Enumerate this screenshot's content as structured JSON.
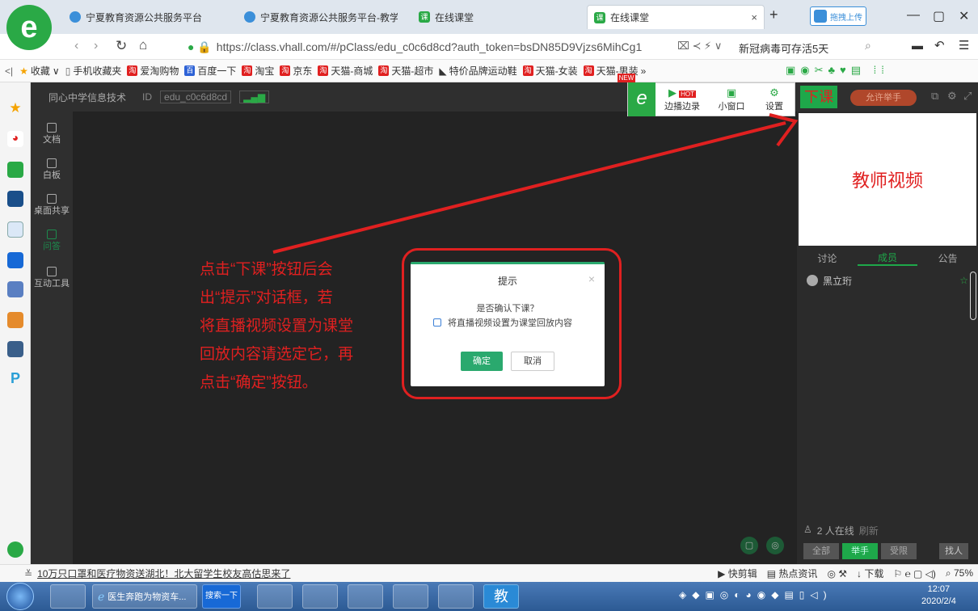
{
  "browser": {
    "tabs": [
      {
        "label": "宁夏教育资源公共服务平台"
      },
      {
        "label": "宁夏教育资源公共服务平台-教学"
      },
      {
        "label": "在线课堂"
      },
      {
        "label": "在线课堂"
      }
    ],
    "new_tab_symbol": "+",
    "close_symbol": "×",
    "upload_button": "拖拽上传",
    "window_controls": {
      "minimize": "—",
      "maximize": "▢",
      "close": "✕"
    },
    "url": "https://class.vhall.com/#/pClass/edu_c0c6d8cd?auth_token=bsDN85D9Vjzs6MihCg1",
    "url_host_bold": "vhall.com",
    "news_ticker": "新冠病毒可存活5天",
    "bookmarks": [
      "收藏",
      "手机收藏夹",
      "爱淘购物",
      "百度一下",
      "淘宝",
      "京东",
      "天猫-商城",
      "天猫-超市",
      "特价品牌运动鞋",
      "天猫-女装",
      "天猫-男装"
    ],
    "new_badge": "NEW"
  },
  "classroom": {
    "school": "同心中学信息技术",
    "id_label": "ID",
    "id_value": "edu_c0c6d8cd",
    "nav": [
      "文档",
      "白板",
      "桌面共享",
      "问答",
      "互动工具"
    ],
    "toolbar": {
      "hot_badge": "HOT",
      "side_record": "边播边录",
      "small_window": "小窗口",
      "settings": "设置"
    },
    "end_class_button": "下课",
    "allow_raise_hand": "允许举手",
    "teacher_video_label": "教师视频",
    "panel_tabs": [
      "讨论",
      "成员",
      "公告"
    ],
    "members": [
      {
        "name": "黑立珩"
      }
    ],
    "online": {
      "count_text": "2 人在线",
      "refresh": "刷新"
    },
    "filters": [
      "全部",
      "举手",
      "受限"
    ],
    "find_button": "找人"
  },
  "annotation": {
    "lines": [
      "点击“下课”按钮后会",
      "出“提示”对话框，若",
      "将直播视频设置为课堂",
      "回放内容请选定它，再",
      "点击“确定”按钮。"
    ]
  },
  "dialog": {
    "title": "提示",
    "close_symbol": "×",
    "question": "是否确认下课？",
    "checkbox_label": "将直播视频设置为课堂回放内容",
    "checkbox_checked": false,
    "confirm": "确定",
    "cancel": "取消"
  },
  "statusbar": {
    "headline": "10万只口罩和医疗物资送湖北！北大留学生校友高估思来了",
    "items": [
      "快剪辑",
      "热点资讯",
      "下载"
    ],
    "zoom": "75%"
  },
  "taskbar": {
    "ie_window": "医生奔跑为物资车...",
    "search_button": "搜索一下",
    "edu_icon_text": "教",
    "time": "12:07",
    "date": "2020/2/4"
  },
  "colors": {
    "accent_green": "#2aa96e",
    "annotation_red": "#e02020",
    "end_class_bg": "#1ea84a",
    "raise_hand_bg": "#b0472b"
  }
}
